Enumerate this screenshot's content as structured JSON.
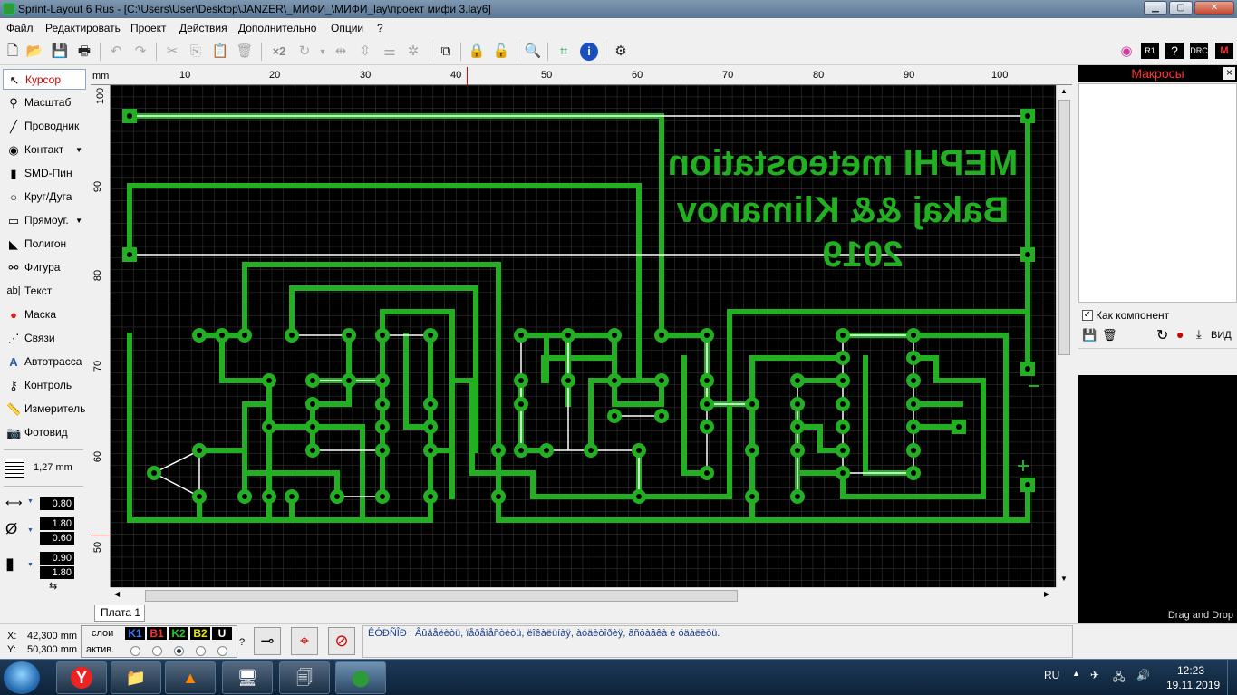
{
  "window": {
    "title": "Sprint-Layout 6 Rus - [C:\\Users\\User\\Desktop\\JANZER\\_МИФИ_\\МИФИ_lay\\проект мифи 3.lay6]"
  },
  "menu": [
    "Файл",
    "Редактировать",
    "Проект",
    "Действия",
    "Дополнительно",
    "Опции",
    "?"
  ],
  "toolbar": {
    "zoom_x2": "×2"
  },
  "tools": [
    {
      "label": "Курсор",
      "icon": "cursor-icon"
    },
    {
      "label": "Масштаб",
      "icon": "zoom-icon"
    },
    {
      "label": "Проводник",
      "icon": "track-icon"
    },
    {
      "label": "Контакт",
      "icon": "pad-icon"
    },
    {
      "label": "SMD-Пин",
      "icon": "smd-icon"
    },
    {
      "label": "Круг/Дуга",
      "icon": "circle-icon"
    },
    {
      "label": "Прямоуг.",
      "icon": "rect-icon"
    },
    {
      "label": "Полигон",
      "icon": "polygon-icon"
    },
    {
      "label": "Фигура",
      "icon": "figure-icon"
    },
    {
      "label": "Текст",
      "icon": "text-icon"
    },
    {
      "label": "Маска",
      "icon": "mask-icon"
    },
    {
      "label": "Связи",
      "icon": "connections-icon"
    },
    {
      "label": "Автотрасса",
      "icon": "autoroute-icon"
    },
    {
      "label": "Контроль",
      "icon": "test-icon"
    },
    {
      "label": "Измеритель",
      "icon": "measure-icon"
    },
    {
      "label": "Фотовид",
      "icon": "photoview-icon"
    }
  ],
  "grid": {
    "value": "1,27 mm"
  },
  "dims": {
    "track_width": "0.80",
    "pad_outer": "1.80",
    "pad_inner": "0.60",
    "smd_w": "0.90",
    "smd_h": "1.80"
  },
  "ruler": {
    "unit": "mm",
    "top": [
      "10",
      "20",
      "30",
      "40",
      "50",
      "60",
      "70",
      "80",
      "90",
      "100"
    ],
    "left": [
      "100",
      "90",
      "80",
      "70",
      "60",
      "50"
    ]
  },
  "board_text": {
    "line1": "MEPHI meteostation",
    "line2": "Bakaj && Klimanov",
    "line3": "2019"
  },
  "board_tab": "Плата 1",
  "macros": {
    "header": "Макросы",
    "close": "×",
    "as_component": "Как компонент",
    "view_button": "ВИД",
    "drag_drop": "Drag and Drop"
  },
  "status": {
    "x_label": "X:",
    "x_value": "42,300 mm",
    "y_label": "Y:",
    "y_value": "50,300 mm",
    "layers_label": "слои",
    "active_label": "актив.",
    "layers": [
      "K1",
      "B1",
      "K2",
      "B2",
      "U"
    ],
    "layer_colors": [
      "#3a7bff",
      "#ff3030",
      "#22cc22",
      "#e8e800",
      "#ffffff"
    ],
    "active_layer": "K2",
    "help": "?",
    "hint": "ÊÓÐÑÎÐ : Âûäåëèòü, ïåðåìåñòèòü, ëîêàëüíàÿ, àóäèòîðèÿ, âñòàâêà è óäàëèòü."
  },
  "taskbar": {
    "lang": "RU",
    "time": "12:23",
    "date": "19.11.2019"
  },
  "colors": {
    "copper": "#22b022",
    "canvas_bg": "#000000",
    "grid": "#3c3c3c",
    "airwire": "#ffffff"
  }
}
